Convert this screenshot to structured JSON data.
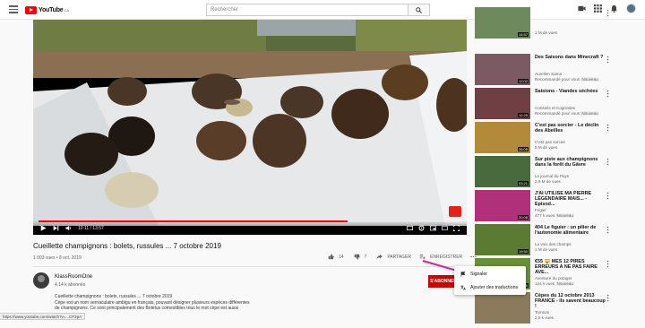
{
  "header": {
    "logo_text": "YouTube",
    "logo_country": "CA",
    "search_placeholder": "Rechercher"
  },
  "player": {
    "time": "10:11 / 13:57",
    "progress": 0.73
  },
  "video": {
    "title": "Cueillette champignons : bolets, russules ... 7 octobre 2019",
    "views": "1 003 vues • 8 oct. 2019",
    "likes": "14",
    "dislikes": "7",
    "share_label": "PARTAGER",
    "save_label": "ENREGISTRER",
    "channel_name": "KlassRoomOne",
    "subscribers": "4,14 k abonnés",
    "description_lines": [
      "Cueillette champignons : bolets, russules ... 7 octobre 2019",
      "Cèpe est un nom vernaculaire ambigu en français, pouvant désigner plusieurs espèces différentes",
      "de champignons. Ce sont principalement des Boletus comestibles tous le mot cèpe est aussi"
    ],
    "subscribe_label": "S'ABONNER"
  },
  "status_url": "https://www.youtube.com/watch?v=...CF2pA",
  "context_menu": {
    "items": [
      "Signaler",
      "Ajouter des traductions"
    ]
  },
  "sidebar": {
    "items": [
      {
        "title": "",
        "channel": "",
        "meta": "1 M de vues",
        "duration": "14:57",
        "thumb": "#6e8a5c"
      },
      {
        "title": "Des Saisons dans Minecraft ?",
        "channel": "Aurelien Sama",
        "meta": "Recommandé pour vous",
        "badge": "Nouveau",
        "duration": "12:02",
        "thumb": "#7c5a64"
      },
      {
        "title": "Saisions - Viandes séchées",
        "channel": "Conseils et Cognottes",
        "meta": "Recommandé pour vous",
        "badge": "Nouveau",
        "duration": "12:29",
        "thumb": "#6f3f44"
      },
      {
        "title": "C'est pas sorcier - Le déclin des Abeilles",
        "channel": "C'est pas sorcier",
        "meta": "5 M de vues",
        "duration": "26:05",
        "thumb": "#b38a3a"
      },
      {
        "title": "Sur piste aux champignons dans la forêt du Gâvre",
        "channel": "Le journal du Pays",
        "meta": "2,6 M de vues",
        "duration": "03:21",
        "thumb": "#486a3c"
      },
      {
        "title": "J'AI UTILISÉ MA PIERRE LÉGENDAIRE MAIS... - Episod...",
        "channel": "Frigiel",
        "meta": "477 k vues",
        "badge": "Nouveau",
        "duration": "20:08",
        "thumb": "#b0307a"
      },
      {
        "title": "404 Le figuier : un pilier de l'autonomie alimentaire",
        "channel": "La voix des champs",
        "meta": "1 M de vues",
        "duration": "19:50",
        "thumb": "#5b7b33"
      },
      {
        "title": "€55 😱 MES 12 PIRES ERREURS A NE PAS FAIRE AVE...",
        "channel": "Aventure du potager",
        "meta": "124 k vues",
        "badge": "Nouveau",
        "duration": "12:16",
        "thumb": "#6a8f3a"
      },
      {
        "title": "Cèpes du 12 octobre 2013 FRANCE - ils savent beaucoup !",
        "channel": "Tomtom",
        "meta": "2,5 k vues",
        "duration": "",
        "thumb": "#8c7a5c"
      }
    ]
  },
  "colors": {
    "accent": "#ff0000",
    "subscribe": "#cc0000",
    "arrow": "#e0209a"
  }
}
